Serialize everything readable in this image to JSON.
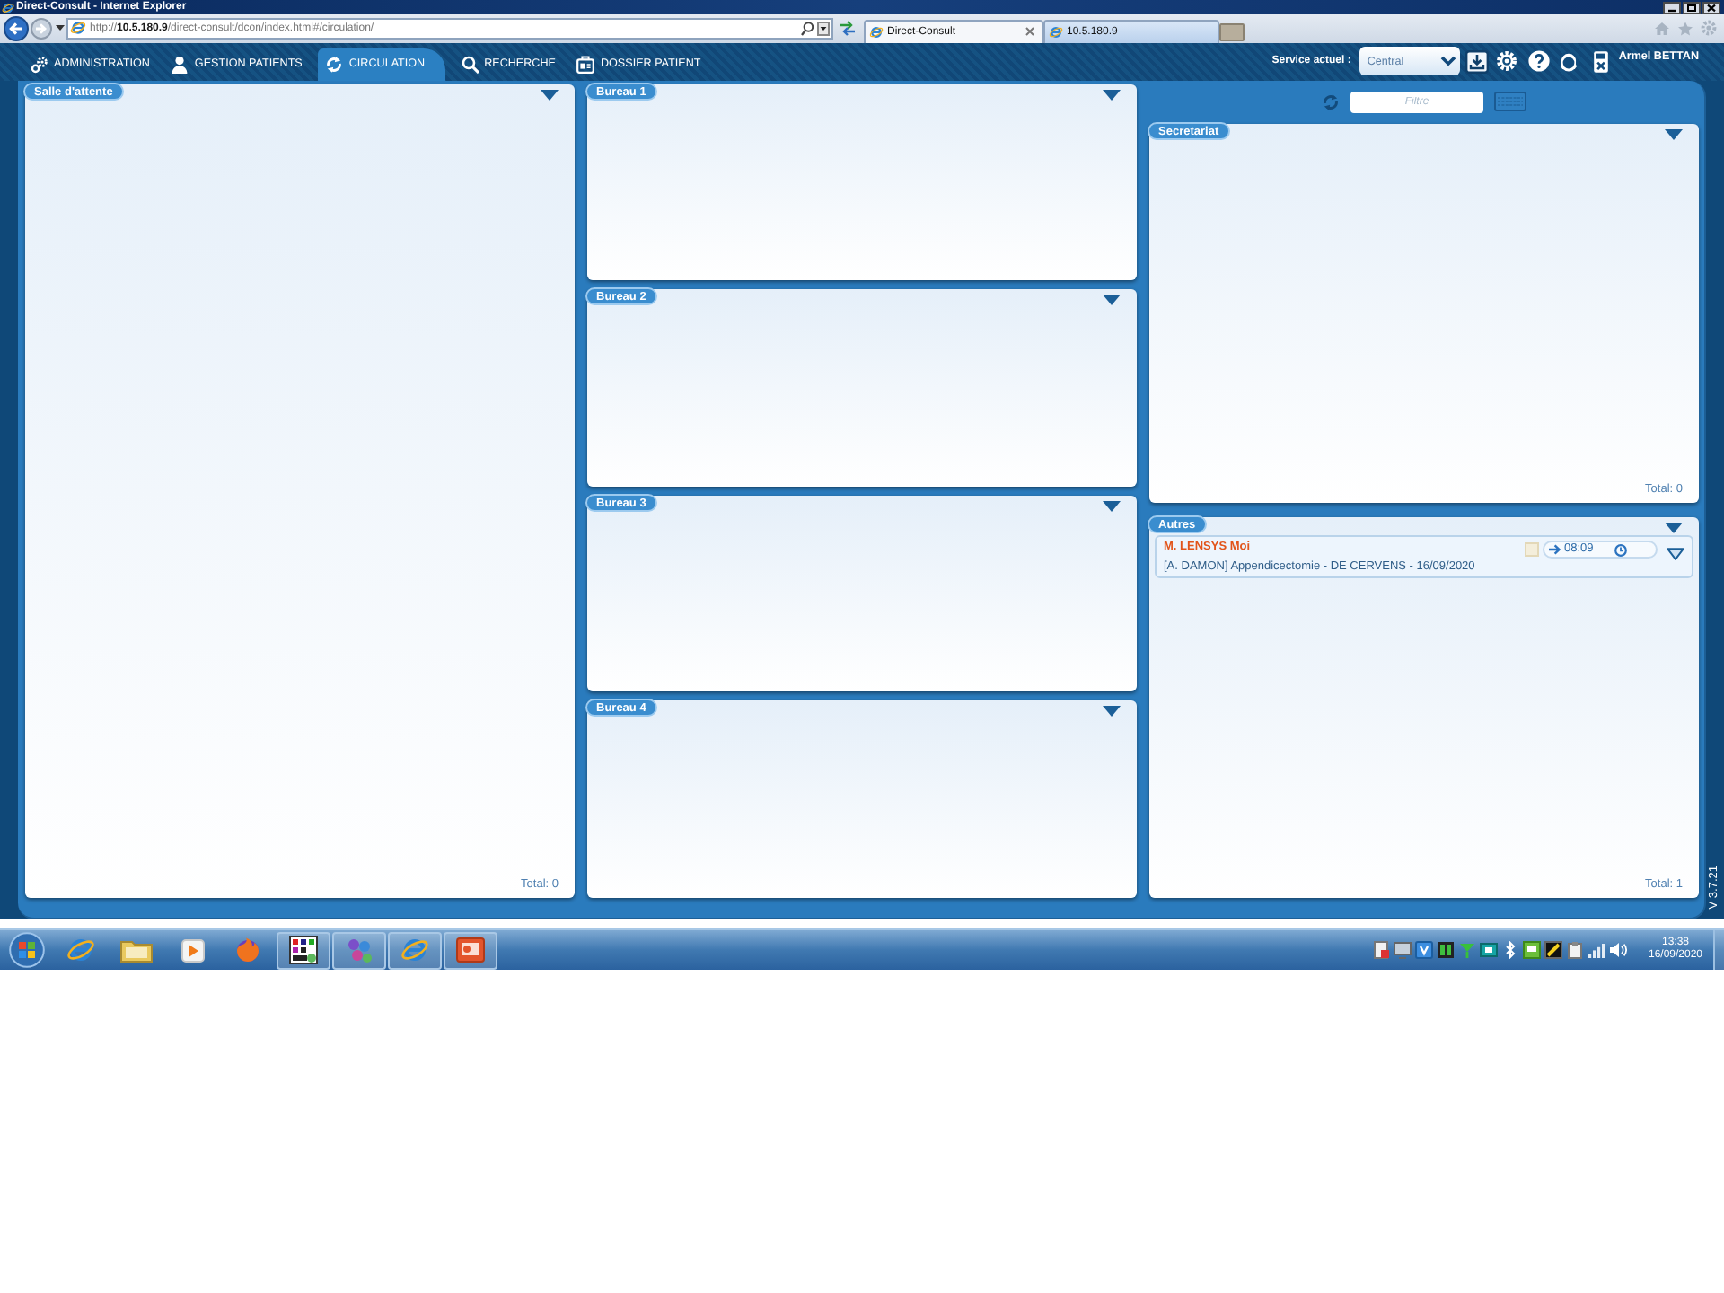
{
  "browser": {
    "title": "Direct-Consult - Internet Explorer",
    "address": "http://**10.5.180.9**/direct-consult/dcon/index.html#/circulation/",
    "tabs": [
      {
        "label": "Direct-Consult",
        "selected": true
      },
      {
        "label": "10.5.180.9",
        "selected": false
      }
    ]
  },
  "nav": {
    "tabs": [
      {
        "label": "ADMINISTRATION",
        "selected": false
      },
      {
        "label": "GESTION PATIENTS",
        "selected": false
      },
      {
        "label": "CIRCULATION",
        "selected": true
      },
      {
        "label": "RECHERCHE",
        "selected": false
      },
      {
        "label": "DOSSIER PATIENT",
        "selected": false
      }
    ],
    "service_label": "Service actuel :",
    "service": "Central",
    "user": "Armel BETTAN"
  },
  "columns": [
    {
      "panels": [
        {
          "title": "Salle d'attente",
          "total": "Total: 0"
        }
      ]
    },
    {
      "panels": [
        {
          "title": "Bureau 1"
        },
        {
          "title": "Bureau 2"
        },
        {
          "title": "Bureau 3"
        },
        {
          "title": "Bureau 4"
        }
      ]
    },
    {
      "filter": {
        "placeholder": "Filtre"
      },
      "panels": [
        {
          "title": "Secretariat",
          "total": "Total: 0"
        },
        {
          "title": "Autres",
          "total": "Total: 1",
          "patients": [
            {
              "name": "M. LENSYS Moi",
              "time": "08:09",
              "details": "[A. DAMON] Appendicectomie - DE CERVENS - 16/09/2020"
            }
          ]
        }
      ]
    }
  ],
  "version": "V 3.7.21",
  "taskbar": {
    "apps": [
      {
        "running": false
      },
      {
        "running": false
      },
      {
        "running": false
      },
      {
        "running": false
      },
      {
        "running": true
      },
      {
        "running": true
      },
      {
        "running": true
      },
      {
        "running": true
      }
    ],
    "time": "13:38",
    "date": "16/09/2020"
  }
}
